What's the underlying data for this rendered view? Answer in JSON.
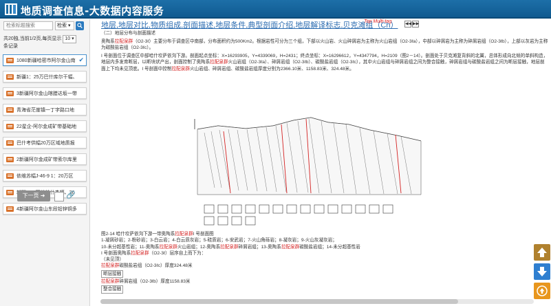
{
  "header": {
    "title": "地质调查信息-大数据内容服务"
  },
  "sidebar": {
    "search_placeholder": "检索标题搜索",
    "search_scope": "检索 ▾",
    "result_info": "共20独,当前1/2页,每页显示",
    "page_size": "10 ▾",
    "result_info_suffix": "条记录",
    "items": [
      {
        "label": "1080新疆哈密市阿尔金山南",
        "active": true
      },
      {
        "label": "新疆1：25万巴什库尔干幅、",
        "active": false
      },
      {
        "label": "3新疆阿尔金山喀腊达坂一带",
        "active": false
      },
      {
        "label": "青海省茫崖镇一丁字路口地",
        "active": false
      },
      {
        "label": "22星企-阿尔金成矿带基础地",
        "active": false
      },
      {
        "label": "巴什考供幅20万区域地质报",
        "active": false
      },
      {
        "label": "2新疆阿尔金成矿带索尔库里",
        "active": false
      },
      {
        "label": "依维苏幅J-46-9 1：20万区",
        "active": false
      },
      {
        "label": "新疆1:25万苏普什杰幅、36",
        "active": false
      },
      {
        "label": "4新疆阿尔金山东段铅锌铜多",
        "active": false
      }
    ],
    "next_label": "下一页 ➜"
  },
  "main": {
    "title": "地层,地层对比,物质组成,剖面描述,地层条件,典型剖面介绍,地层解译标志,贝克滩组（Ch）",
    "tags": "Top  Multi-tag",
    "section_heading": "（二）地层分布与剖面描述",
    "para1_prefix": "奥陶系",
    "para1_red": "拉配泉群",
    "para1_text": "（O2-3ℓ）主要分布于调查区中南部，分布面积约为500Km2。根据岩性可分为三个组，下部以火山岩、火山碎屑岩为主称为火山岩组（O2-3ℓa），中部以碎屑岩为主称为碎屑岩组（O2-3ℓb），上部以灰岩为主称为碳酸盐岩组（O2-3ℓc）。",
    "para2_prefix": "I 号剖面位于调查区中部哈什坎萨依沟下游。剖面起点坐标：X=16293905，Y=4339069，H=2431；终点坐标：X=16296612，Y=4347794，H=2109（图2－14）。剖面处于贝克滩复背斜的北翼，总体形成向北倾的单斜构造，地层内多发育断层，以断块状产出，剖面控制了奥陶系",
    "para2_red": "拉配泉群",
    "para2_text": "火山岩组（O2-3ℓa）、碎屑岩组（O2-3ℓb）、碳酸盐岩组（O2-3ℓc），其中火山岩组与碎屑岩组之间为整合接触，碎屑岩组与碳酸盐岩组之间为断层接触，地层剖面上下均未见顶底。I 号剖面中控制",
    "para2_red2": "拉配泉群",
    "para2_tail": "火山岩组、碎屑岩组、碳酸盐岩组厚度分别为2366.10米、1158.83米、324.48米。",
    "fig_caption_prefix": "图2-14 哈什坎萨依沟下游一带奥陶系",
    "fig_caption_red": "拉配泉群",
    "fig_caption_suffix": "I 号剖面图",
    "legend_line1": "1-凝屑砂岩；2-粉砂岩；3-白云岩；4-白云质灰岩；5-硅质岩；6-安武岩；7-火山角砾岩；8-凝灰岩；9-火山灰凝灰岩；",
    "legend_line2_prefix": "10-未分超基性岩；11-奥陶系",
    "legend_line2_red1": "拉配泉群",
    "legend_line2_mid1": "火山岩组；12-奥陶系",
    "legend_line2_red2": "拉配泉群",
    "legend_line2_mid2": "碎屑岩组；13-奥陶系",
    "legend_line2_red3": "拉配泉群",
    "legend_line2_tail": "碳酸盐岩组；14-未分超基性岩",
    "section_line_prefix": "I 号剖面奥陶系",
    "section_line_red": "拉配泉群",
    "section_line_suffix": "（O2-3ℓ）层序自上而下为：",
    "not_top": "（未见顶）",
    "row1_red": "拉配泉群",
    "row1_text": "碳酸盐岩组（O2-3ℓc）厚度324.48米",
    "row1_box": "断层接触",
    "row2_red": "拉配泉群",
    "row2_text": "碎屑岩组（O2-3ℓb）厚度1158.83米",
    "row2_box": "整合接触"
  },
  "colors": {
    "header_bg": "#1d6fa8",
    "accent": "#2a7abf",
    "highlight": "#d42020"
  },
  "icons": [
    "logo-icon",
    "search-icon",
    "document-icon",
    "check-icon",
    "link-icon",
    "arrow-up-icon",
    "arrow-down-icon",
    "back-to-top-icon"
  ]
}
